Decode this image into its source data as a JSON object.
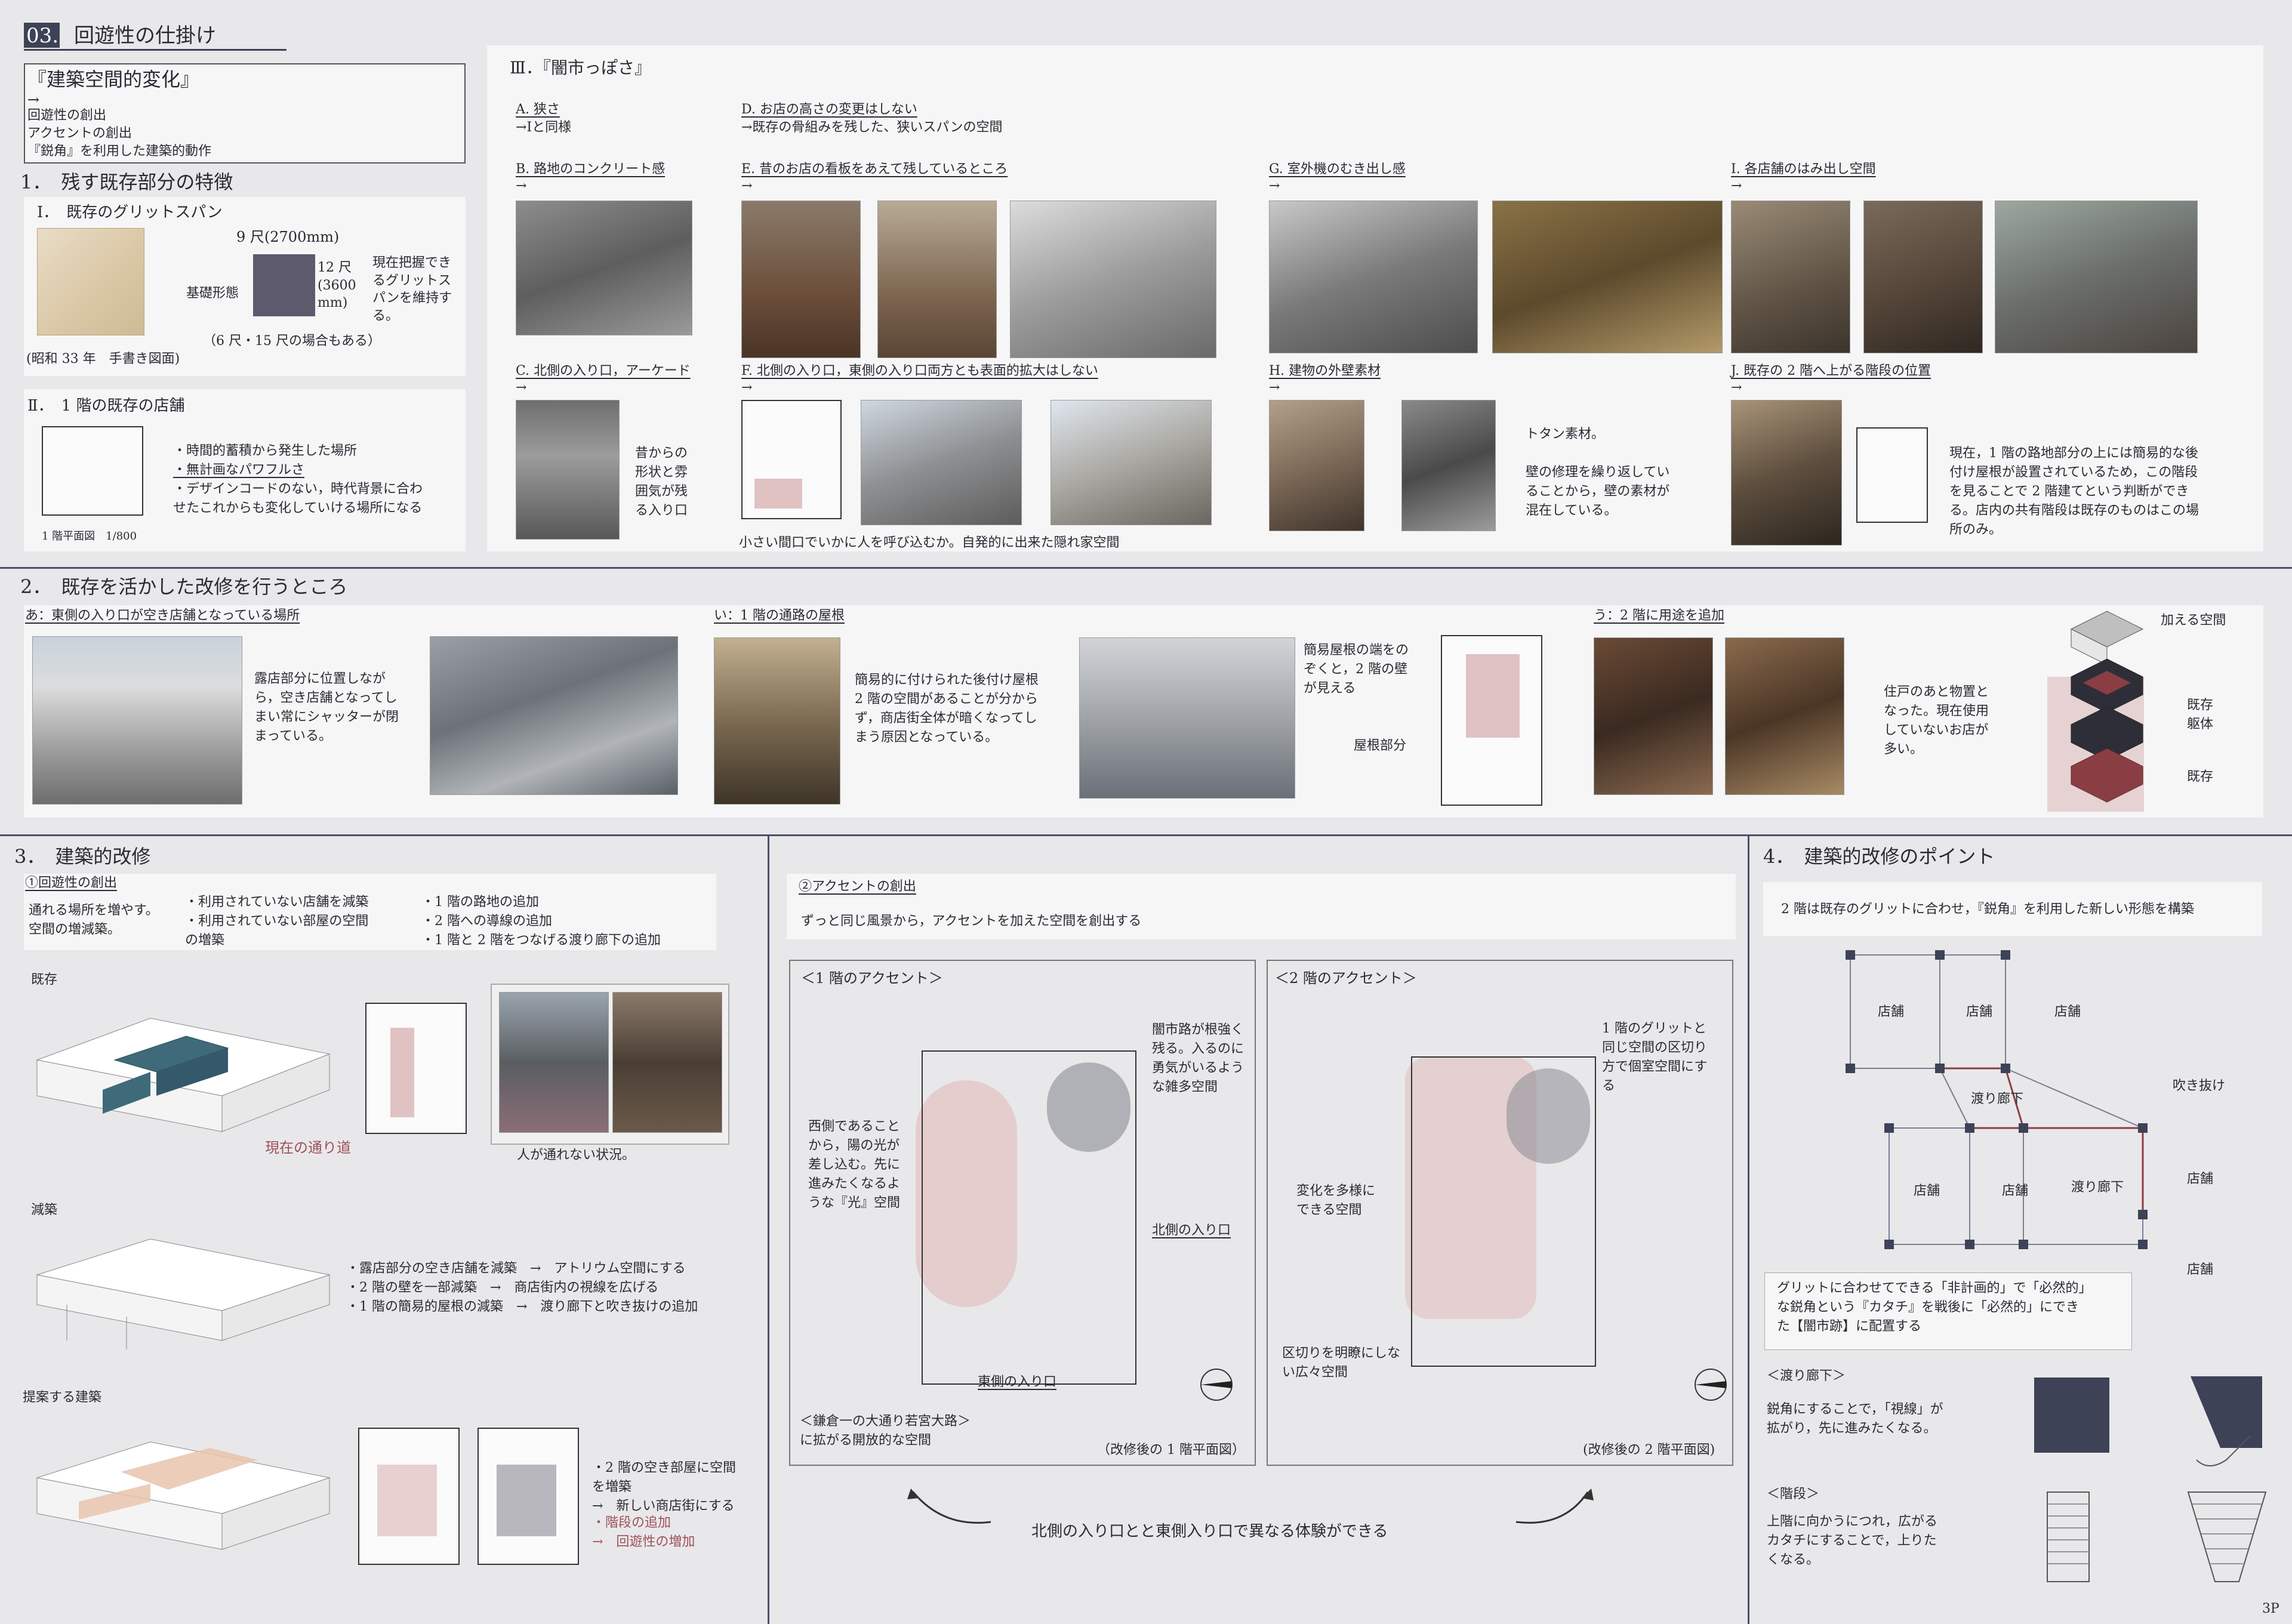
{
  "header": {
    "number": "03.",
    "title": "回遊性の仕掛け"
  },
  "intro_box": {
    "heading": "『建築空間的変化』",
    "arrow": "→",
    "lines": [
      "回遊性の創出",
      "アクセントの創出",
      "『鋭角』を利用した建築的動作"
    ]
  },
  "section1": {
    "heading": "1．　残す既存部分の特徴",
    "grid": {
      "label": "Ⅰ．　既存のグリットスパン",
      "dim_top": "9 尺(2700mm)",
      "dim_side": "12 尺\n(3600\nmm)",
      "foundation": "基礎形態",
      "note": "現在把握でき\nるグリットス\nパンを維持す\nる。",
      "sub": "（6 尺・15 尺の場合もある）",
      "caption": "(昭和 33 年　手書き図面)"
    },
    "shops": {
      "label": "Ⅱ．　1 階の既存の店舗",
      "items": [
        "・時間的蓄積から発生した場所",
        "・無計画なパワフルさ",
        "・デザインコードのない，時代背景に合わ\nせたこれからも変化していける場所になる"
      ],
      "scale": "1 階平面図　1/800"
    }
  },
  "section3a": {
    "heading": "Ⅲ．『闇市っぽさ』",
    "A": {
      "title": "A. 狭さ",
      "text": "→Ⅰと同様"
    },
    "D": {
      "title": "D. お店の高さの変更はしない",
      "text": "→既存の骨組みを残した、狭いスパンの空間"
    },
    "B": {
      "title": "B. 路地のコンクリート感",
      "arrow": "→"
    },
    "E": {
      "title": "E. 昔のお店の看板をあえて残しているところ",
      "arrow": "→"
    },
    "G": {
      "title": "G. 室外機のむき出し感",
      "arrow": "→"
    },
    "I": {
      "title": "I. 各店舗のはみ出し空間",
      "arrow": "→"
    },
    "C": {
      "title": "C. 北側の入り口，アーケード",
      "arrow": "→",
      "text": "昔からの\n形状と雰\n囲気が残\nる入り口"
    },
    "F": {
      "title": "F. 北側の入り口，東側の入り口両方とも表面的拡大はしない",
      "arrow": "→",
      "text": "小さい間口でいかに人を呼び込むか。自発的に出来た隠れ家空間"
    },
    "H": {
      "title": "H. 建物の外壁素材",
      "arrow": "→",
      "text": "トタン素材。\n\n壁の修理を繰り返してい\nることから，壁の素材が\n混在している。"
    },
    "J": {
      "title": "J. 既存の 2 階へ上がる階段の位置",
      "arrow": "→",
      "text": "現在，1 階の路地部分の上には簡易的な後\n付け屋根が設置されているため，この階段\nを見ることで 2 階建てという判断ができ\nる。店内の共有階段は既存のものはこの場\n所のみ。"
    }
  },
  "section2": {
    "heading": "2．　既存を活かした改修を行うところ",
    "a": {
      "title": "あ：東側の入り口が空き店舗となっている場所",
      "text": "露店部分に位置しなが\nら，空き店舗となってし\nまい常にシャッターが閉\nまっている。"
    },
    "i": {
      "title": "い：1 階の通路の屋根",
      "text": "簡易的に付けられた後付け屋根\n2 階の空間があることが分から\nず，商店街全体が暗くなってし\nまう原因となっている。",
      "note": "簡易屋根の端をの\nぞくと，2 階の壁\nが見える",
      "roof": "屋根部分"
    },
    "u": {
      "title": "う：2 階に用途を追加",
      "text": "住戸のあと物置と\nなった。現在使用\nしていないお店が\n多い。",
      "add": "加える空間",
      "frame": "既存\n躯体",
      "exist": "既存"
    }
  },
  "section3": {
    "heading": "3．　建築的改修",
    "sub1": "①回遊性の創出",
    "lead": "通れる場所を増やす。\n空間の増減築。",
    "bullets1": "・利用されていない店舗を減築\n・利用されていない部屋の空間\nの増築",
    "bullets2": "・1 階の路地の追加\n・2 階への導線の追加\n・1 階と 2 階をつなげる渡り廊下の追加",
    "exist_label": "既存",
    "current_path": "現在の通り道",
    "no_pass": "人が通れない状況。",
    "demol_label": "減築",
    "demol_text": "・露店部分の空き店舗を減築　→　アトリウム空間にする\n・2 階の壁を一部減築　→　商店街内の視線を広げる\n・1 階の簡易的屋根の減築　→　渡り廊下と吹き抜けの追加",
    "proposal_label": "提案する建築",
    "proposal_text1": "・2 階の空き部屋に空間\nを増築\n→　新しい商店街にする",
    "proposal_text2": "・階段の追加\n→　回遊性の増加"
  },
  "accent": {
    "sub": "②アクセントの創出",
    "lead": "ずっと同じ風景から，アクセントを加えた空間を創出する",
    "f1": {
      "title": "＜1 階のアクセント＞",
      "west": "西側であること\nから，陽の光が\n差し込む。先に\n進みたくなるよ\nうな『光』空間",
      "yami": "闇市路が根強く\n残る。入るのに\n勇気がいるよう\nな雑多空間",
      "north": "北側の入り口",
      "east": "東側の入り口",
      "main": "＜鎌倉一の大通り若宮大路＞\nに拡がる開放的な空間",
      "caption": "（改修後の 1 階平面図）"
    },
    "f2": {
      "title": "＜2 階のアクセント＞",
      "grid": "1 階のグリットと\n同じ空間の区切り\n方で個室空間にす\nる",
      "change": "変化を多様に\nできる空間",
      "wide": "区切りを明瞭にしな\nい広々空間",
      "caption": "(改修後の 2 階平面図)"
    },
    "footer": "北側の入り口とと東側入り口で異なる体験ができる"
  },
  "section4": {
    "heading": "4．　建築的改修のポイント",
    "lead": "2 階は既存のグリットに合わせ，『鋭角』を利用した新しい形態を構築",
    "shop": "店舗",
    "corridor": "渡り廊下",
    "void": "吹き抜け",
    "note": "グリットに合わせてできる「非計画的」で「必然的」\nな鋭角という『カタチ』を戦後に「必然的」にでき\nた【闇市跡】に配置する",
    "corr_title": "＜渡り廊下＞",
    "corr_text": "鋭角にすることで，「視線」が\n拡がり，先に進みたくなる。",
    "stair_title": "＜階段＞",
    "stair_text": "上階に向かうにつれ，広がる\nカタチにすることで，上りた\nくなる。"
  },
  "page_number": "3P"
}
